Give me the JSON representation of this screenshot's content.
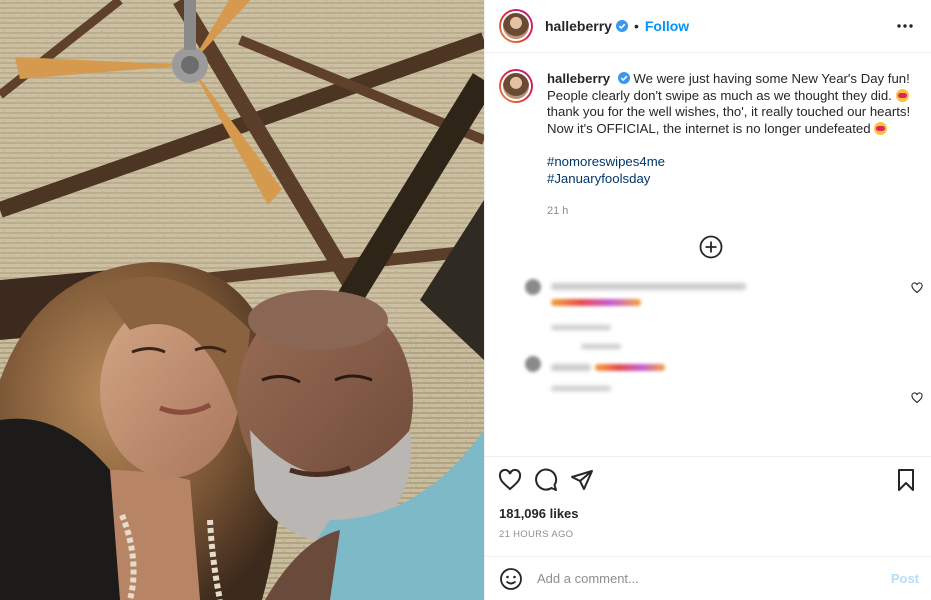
{
  "post": {
    "username": "halleberry",
    "follow_label": "Follow",
    "separator": "•"
  },
  "caption": {
    "username": "halleberry",
    "text_1": "We were just having some New Year's Day fun! People clearly don't swipe as much as we thought they did.",
    "text_2": "thank you for the well wishes, tho', it really touched our hearts! Now it's OFFICIAL, the internet is no longer undefeated",
    "hashtags": [
      "#nomoreswipes4me",
      "#Januaryfoolsday"
    ],
    "time": "21 h"
  },
  "engagement": {
    "likes": "181,096 likes",
    "posted": "21 HOURS AGO"
  },
  "comment_box": {
    "placeholder": "Add a comment...",
    "post_label": "Post"
  },
  "icons": [
    "verified-badge-icon",
    "more-options-icon",
    "load-more-comments-icon",
    "heart-icon",
    "comment-icon",
    "share-icon",
    "bookmark-icon",
    "emoji-icon"
  ],
  "colors": {
    "accent": "#0095f6",
    "hashtag": "#00376b",
    "post_disabled": "#b2dffc"
  }
}
